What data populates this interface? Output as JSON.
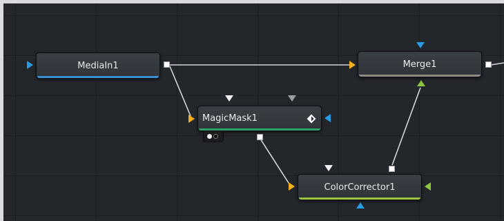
{
  "nodes": {
    "mediain": {
      "label": "MediaIn1"
    },
    "merge": {
      "label": "Merge1"
    },
    "magicmask": {
      "label": "MagicMask1"
    },
    "colorcorrector": {
      "label": "ColorCorrector1"
    }
  },
  "colors": {
    "background": "#23262b",
    "node_fill": "#363a40",
    "link": "#d4d6da",
    "bg_input": "#f2b01e",
    "fg_input": "#8cc63a",
    "mask_input": "#2a9be0",
    "mediain_bar": "#3a8fd6",
    "merge_bar": "#8c8a82",
    "magicmask_bar": "#2fa16a",
    "colorcorrector_bar": "#9cc33a"
  },
  "icons": {
    "magicmask_badge": "diamond-icon",
    "magicmask_toggle": "toggle-switch-icon"
  }
}
